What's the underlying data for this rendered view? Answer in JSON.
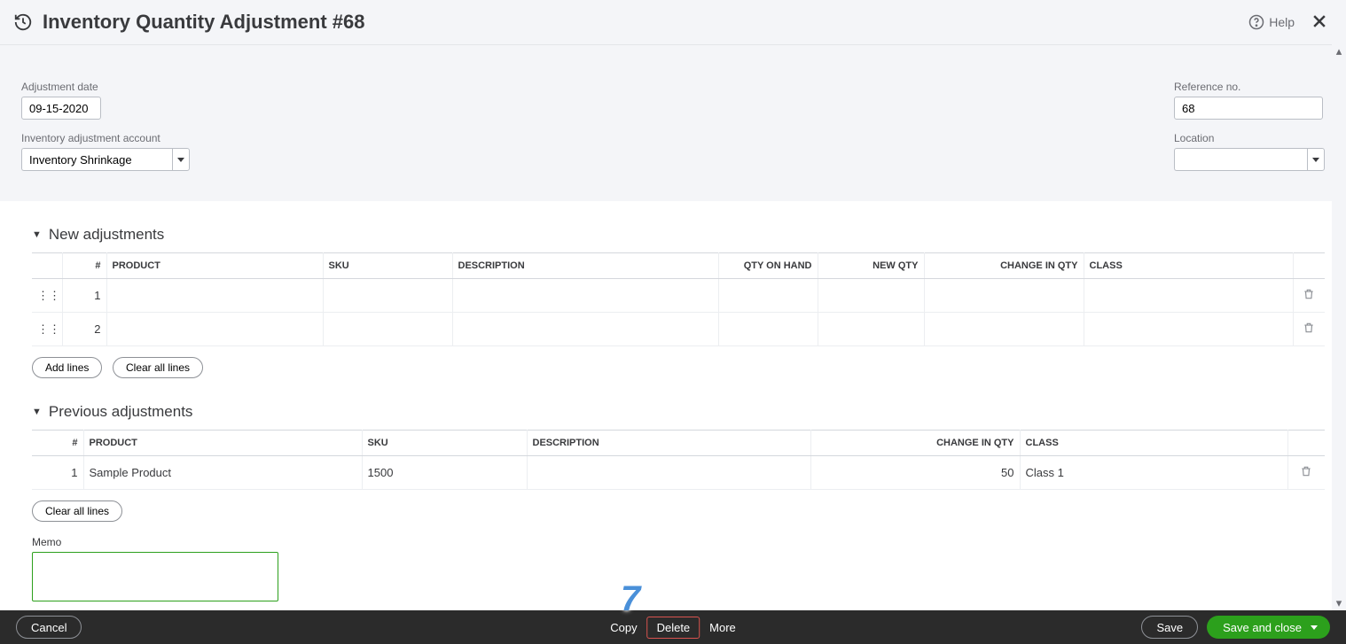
{
  "header": {
    "title": "Inventory Quantity Adjustment #68",
    "help": "Help"
  },
  "form": {
    "adjustment_date_label": "Adjustment date",
    "adjustment_date_value": "09-15-2020",
    "account_label": "Inventory adjustment account",
    "account_value": "Inventory Shrinkage",
    "refno_label": "Reference no.",
    "refno_value": "68",
    "location_label": "Location",
    "location_value": ""
  },
  "sections": {
    "new_adj_title": "New adjustments",
    "prev_adj_title": "Previous adjustments",
    "memo_label": "Memo"
  },
  "buttons": {
    "add_lines": "Add lines",
    "clear_all_lines": "Clear all lines"
  },
  "new_table": {
    "headers": {
      "rownum": "#",
      "product": "PRODUCT",
      "sku": "SKU",
      "description": "DESCRIPTION",
      "qoh": "QTY ON HAND",
      "newqty": "NEW QTY",
      "change": "CHANGE IN QTY",
      "class": "CLASS"
    },
    "rows": [
      {
        "n": "1"
      },
      {
        "n": "2"
      }
    ]
  },
  "prev_table": {
    "headers": {
      "rownum": "#",
      "product": "PRODUCT",
      "sku": "SKU",
      "description": "DESCRIPTION",
      "change": "CHANGE IN QTY",
      "class": "CLASS"
    },
    "rows": [
      {
        "n": "1",
        "product": "Sample Product",
        "sku": "1500",
        "description": "",
        "change": "50",
        "class": "Class 1"
      }
    ]
  },
  "footer": {
    "cancel": "Cancel",
    "copy": "Copy",
    "delete": "Delete",
    "more": "More",
    "save": "Save",
    "save_close": "Save and close"
  },
  "annotation": {
    "step": "7"
  }
}
